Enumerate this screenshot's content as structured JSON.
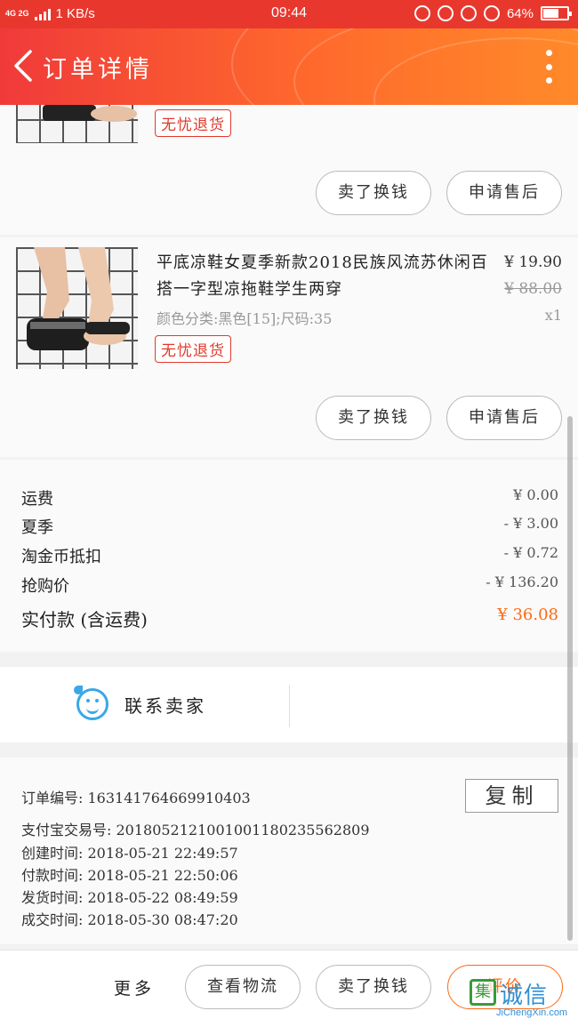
{
  "status_bar": {
    "network": "4G 2G",
    "speed": "1 KB/s",
    "time": "09:44",
    "battery": "64%"
  },
  "header": {
    "title": "订单详情"
  },
  "items": [
    {
      "badge": "无忧退货",
      "actions": [
        "卖了换钱",
        "申请售后"
      ]
    },
    {
      "title": "平底凉鞋女夏季新款2018民族风流苏休闲百搭一字型凉拖鞋学生两穿",
      "spec": "颜色分类:黑色[15];尺码:35",
      "price": "¥ 19.90",
      "original_price": "¥ 88.00",
      "quantity": "x1",
      "badge": "无忧退货",
      "actions": [
        "卖了换钱",
        "申请售后"
      ]
    }
  ],
  "fees": [
    {
      "label": "运费",
      "value": "¥ 0.00"
    },
    {
      "label": "夏季",
      "value": "- ¥ 3.00"
    },
    {
      "label": "淘金币抵扣",
      "value": "- ¥ 0.72"
    },
    {
      "label": "抢购价",
      "value": "- ¥ 136.20"
    },
    {
      "label": "实付款 (含运费)",
      "value": "¥ 36.08"
    }
  ],
  "contact": {
    "label": "联系卖家"
  },
  "order_info": {
    "rows": [
      "订单编号: 163141764669910403",
      "支付宝交易号: 2018052121001001180235562809",
      "创建时间: 2018-05-21 22:49:57",
      "付款时间: 2018-05-21 22:50:06",
      "发货时间: 2018-05-22 08:49:59",
      "成交时间: 2018-05-30 08:47:20"
    ],
    "copy_label": "复制"
  },
  "bottom_bar": {
    "more": "更多",
    "logistics": "查看物流",
    "resell": "卖了换钱",
    "evaluate": "评价"
  },
  "watermark": {
    "logo": "集",
    "text": "诚信",
    "url": "JiChengXin.com"
  },
  "colors": {
    "header_gradient_start": "#f03a3a",
    "header_gradient_end": "#ff8a2a",
    "badge_red": "#e0392b",
    "total_orange": "#ff6a14",
    "contact_blue": "#3aa7e8"
  }
}
